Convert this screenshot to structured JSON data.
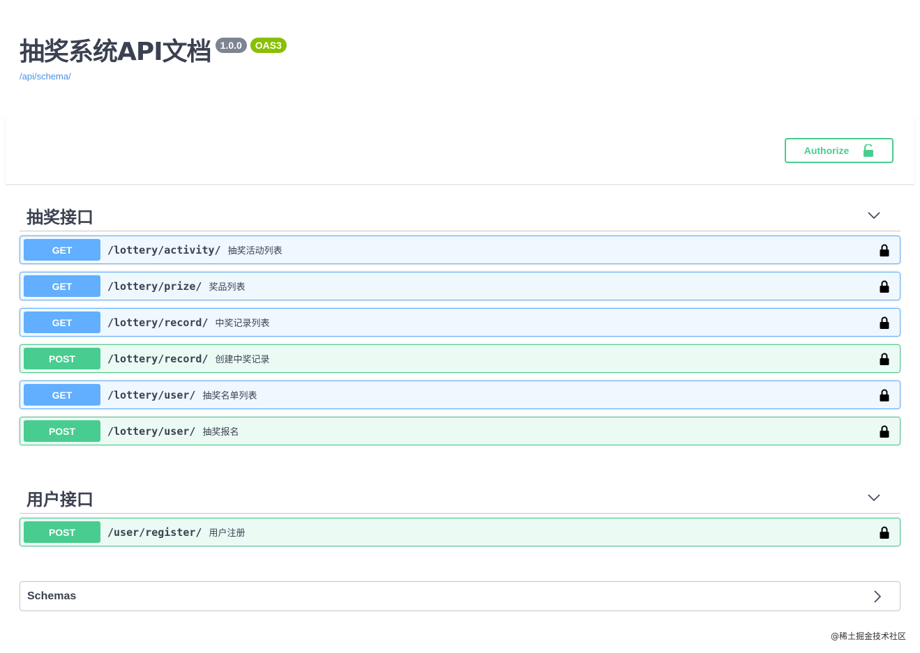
{
  "info": {
    "title": "抽奖系统API文档",
    "version": "1.0.0",
    "oas": "OAS3",
    "schema_link": "/api/schema/"
  },
  "auth": {
    "label": "Authorize",
    "icon": "unlock-icon"
  },
  "tags": [
    {
      "name": "抽奖接口",
      "operations": [
        {
          "method": "GET",
          "path": "/lottery/activity/",
          "summary": "抽奖活动列表"
        },
        {
          "method": "GET",
          "path": "/lottery/prize/",
          "summary": "奖品列表"
        },
        {
          "method": "GET",
          "path": "/lottery/record/",
          "summary": "中奖记录列表"
        },
        {
          "method": "POST",
          "path": "/lottery/record/",
          "summary": "创建中奖记录"
        },
        {
          "method": "GET",
          "path": "/lottery/user/",
          "summary": "抽奖名单列表"
        },
        {
          "method": "POST",
          "path": "/lottery/user/",
          "summary": "抽奖报名"
        }
      ]
    },
    {
      "name": "用户接口",
      "operations": [
        {
          "method": "POST",
          "path": "/user/register/",
          "summary": "用户注册"
        }
      ]
    }
  ],
  "schemas": {
    "label": "Schemas"
  },
  "watermark": "@稀土掘金技术社区",
  "colors": {
    "get": "#61affe",
    "post": "#49cc90",
    "version_badge": "#7d8492",
    "oas_badge": "#89bf04",
    "link": "#4990e2"
  }
}
